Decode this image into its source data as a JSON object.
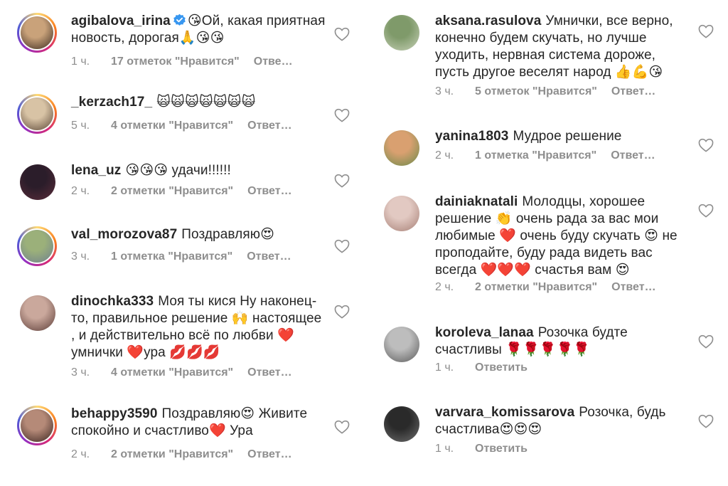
{
  "left": [
    {
      "user": "agibalova_irina",
      "verified": true,
      "text": "😘Ой, какая приятная новость, дорогая🙏😘😘",
      "time": "1 ч.",
      "likes": "17 отметок \"Нравится\"",
      "reply": "Отве…",
      "ring": true
    },
    {
      "user": "_kerzach17_",
      "verified": false,
      "text": "🙀🙀🙀🙀🙀🙀🙀",
      "time": "5 ч.",
      "likes": "4 отметки \"Нравится\"",
      "reply": "Ответ…",
      "ring": true
    },
    {
      "user": "lena_uz",
      "verified": false,
      "text": "😘😘😘 удачи!!!!!!",
      "time": "2 ч.",
      "likes": "2 отметки \"Нравится\"",
      "reply": "Ответ…",
      "ring": false
    },
    {
      "user": "val_morozova87",
      "verified": false,
      "text": "Поздравляю😍",
      "time": "3 ч.",
      "likes": "1 отметка \"Нравится\"",
      "reply": "Ответ…",
      "ring": true
    },
    {
      "user": "dinochka333",
      "verified": false,
      "text": "Моя ты кися  Ну наконец-то, правильное решение 🙌 настоящее , и действительно всё по любви ❤️умнички ❤️ура 💋💋💋",
      "time": "3 ч.",
      "likes": "4 отметки \"Нравится\"",
      "reply": "Ответ…",
      "ring": false
    },
    {
      "user": "behappy3590",
      "verified": false,
      "text": "Поздравляю😍 Живите спокойно и счастливо❤️ Ура",
      "time": "2 ч.",
      "likes": "2 отметки \"Нравится\"",
      "reply": "Ответ…",
      "ring": true
    }
  ],
  "right": [
    {
      "user": "aksana.rasulova",
      "verified": false,
      "text": "Умнички, все верно, конечно будем скучать, но лучше уходить, нервная система дороже, пусть другое веселят народ 👍💪😘",
      "time": "3 ч.",
      "likes": "5 отметок \"Нравится\"",
      "reply": "Ответ…",
      "ring": false
    },
    {
      "user": "yanina1803",
      "verified": false,
      "text": "Мудрое решение",
      "time": "2 ч.",
      "likes": "1 отметка \"Нравится\"",
      "reply": "Ответ…",
      "ring": false
    },
    {
      "user": "dainiaknatali",
      "verified": false,
      "text": "Молодцы, хорошее решение 👏 очень рада за вас мои любимые ❤️ очень буду скучать 😍 не проподайте, буду рада видеть вас всегда ❤️❤️❤️ счастья вам 😍",
      "time": "2 ч.",
      "likes": "2 отметки \"Нравится\"",
      "reply": "Ответ…",
      "ring": false
    },
    {
      "user": "koroleva_lanaa",
      "verified": false,
      "text": "Розочка будте счастливы 🌹🌹🌹🌹🌹",
      "time": "1 ч.",
      "likes": "",
      "reply": "Ответить",
      "ring": false
    },
    {
      "user": "varvara_komissarova",
      "verified": false,
      "text": "Розочка, будь счастлива😍😍😍",
      "time": "1 ч.",
      "likes": "",
      "reply": "Ответить",
      "ring": false
    }
  ],
  "colors": {
    "text": "#262626",
    "meta": "#8e8e8e",
    "verified": "#3897f0"
  },
  "icons": {
    "like": "heart-outline-icon",
    "verified": "verified-badge-icon"
  }
}
